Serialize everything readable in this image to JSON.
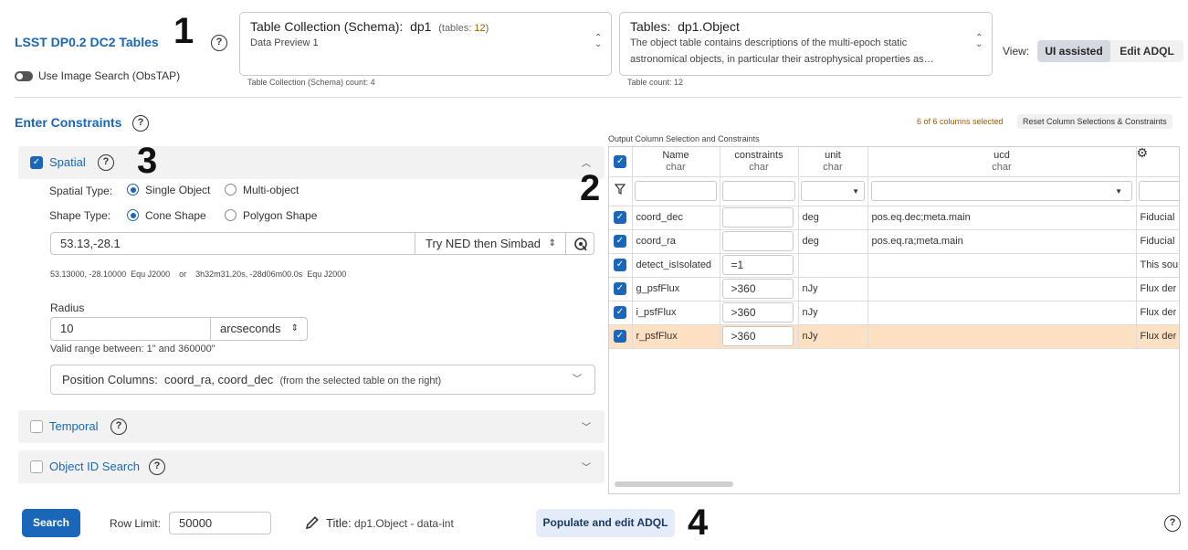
{
  "header": {
    "title": "LSST DP0.2 DC2 Tables",
    "image_search_label": "Use Image Search (ObsTAP)",
    "schema": {
      "label": "Table Collection (Schema):",
      "value": "dp1",
      "tables_label": "(tables:",
      "tables_count": "12",
      "tables_close": ")",
      "description": "Data Preview 1",
      "count_note": "Table Collection (Schema) count: 4"
    },
    "tables": {
      "label": "Tables:",
      "value": "dp1.Object",
      "description_line1": "The object table contains descriptions of the multi-epoch static",
      "description_line2": "astronomical objects, in particular their astrophysical properties as…",
      "count_note": "Table count: 12"
    },
    "view_label": "View:",
    "view_options": [
      "UI assisted",
      "Edit ADQL"
    ]
  },
  "markers": [
    "1",
    "2",
    "3",
    "4"
  ],
  "constraints": {
    "title": "Enter Constraints",
    "spatial": {
      "label": "Spatial",
      "spatial_type_label": "Spatial Type:",
      "spatial_type_options": [
        "Single Object",
        "Multi-object"
      ],
      "shape_type_label": "Shape Type:",
      "shape_type_options": [
        "Cone Shape",
        "Polygon Shape"
      ],
      "position_value": "53.13,-28.1",
      "resolver": "Try NED then Simbad",
      "resolved": "53.13000, -28.10000  Equ J2000    or    3h32m31.20s, -28d06m00.0s  Equ J2000",
      "radius_label": "Radius",
      "radius_value": "10",
      "radius_unit": "arcseconds",
      "valid_range": "Valid range between: 1\" and 360000\"",
      "position_columns_label": "Position Columns:",
      "position_columns_value": "coord_ra, coord_dec",
      "position_columns_note": "(from the selected table on the right)"
    },
    "temporal": {
      "label": "Temporal"
    },
    "object_id": {
      "label": "Object ID Search"
    }
  },
  "columns_panel": {
    "selected_note": "6 of 6 columns selected",
    "reset_label": "Reset Column Selections & Constraints",
    "grid_title": "Output Column Selection and Constraints",
    "headers": [
      {
        "name": "Name",
        "type": "char"
      },
      {
        "name": "constraints",
        "type": "char"
      },
      {
        "name": "unit",
        "type": "char"
      },
      {
        "name": "ucd",
        "type": "char"
      }
    ],
    "rows": [
      {
        "name": "coord_dec",
        "constraint": "",
        "unit": "deg",
        "ucd": "pos.eq.dec;meta.main",
        "desc": "Fiducial"
      },
      {
        "name": "coord_ra",
        "constraint": "",
        "unit": "deg",
        "ucd": "pos.eq.ra;meta.main",
        "desc": "Fiducial"
      },
      {
        "name": "detect_isIsolated",
        "constraint": "=1",
        "unit": "",
        "ucd": "",
        "desc": "This sou"
      },
      {
        "name": "g_psfFlux",
        "constraint": ">360",
        "unit": "nJy",
        "ucd": "",
        "desc": "Flux der"
      },
      {
        "name": "i_psfFlux",
        "constraint": ">360",
        "unit": "nJy",
        "ucd": "",
        "desc": "Flux der"
      },
      {
        "name": "r_psfFlux",
        "constraint": ">360",
        "unit": "nJy",
        "ucd": "",
        "desc": "Flux der"
      }
    ]
  },
  "footer": {
    "search_label": "Search",
    "row_limit_label": "Row Limit:",
    "row_limit_value": "50000",
    "title_label": "Title:",
    "title_value": "dp1.Object - data-int",
    "populate_label": "Populate and edit ADQL"
  },
  "colors": {
    "accent": "#1a66b8",
    "selected_row": "#fde1c2",
    "panel_bg": "#f2f2f2"
  }
}
